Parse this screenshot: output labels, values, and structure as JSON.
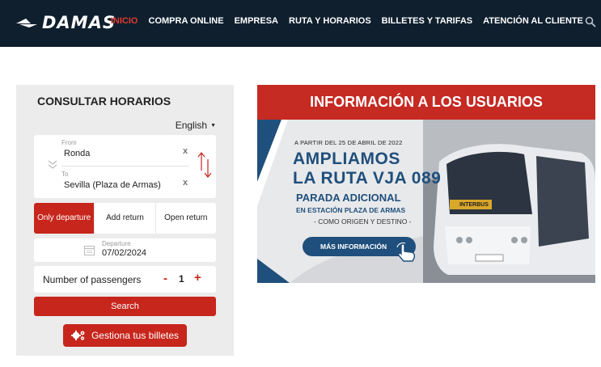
{
  "header": {
    "logo_text": "DAMAS",
    "nav": [
      "INICIO",
      "COMPRA ONLINE",
      "EMPRESA",
      "RUTA Y HORARIOS",
      "BILLETES Y TARIFAS",
      "ATENCIÓN AL CLIENTE"
    ],
    "active_nav": "INICIO",
    "icons": [
      "bus-logo-icon",
      "search-icon"
    ]
  },
  "panel": {
    "title": "CONSULTAR HORARIOS",
    "language": "English",
    "from_label": "From",
    "from_value": "Ronda",
    "to_label": "To",
    "to_value": "Sevilla (Plaza de Armas)",
    "clear_symbol": "x",
    "trip_tabs": [
      "Only departure",
      "Add return",
      "Open return"
    ],
    "date_label": "Departure",
    "date_value": "07/02/2024",
    "passengers_label": "Number of passengers",
    "passengers_minus": "-",
    "passengers_count": "1",
    "passengers_plus": "+",
    "search_label": "Search",
    "manage_label": "Gestiona tus billetes"
  },
  "banner": {
    "title": "INFORMACIÓN A LOS USUARIOS",
    "date_line": "A PARTIR DEL 25 DE ABRIL DE 2022",
    "headline1": "AMPLIAMOS",
    "headline2": "LA RUTA VJA 089",
    "sub1": "PARADA ADICIONAL",
    "sub2": "EN ESTACIÓN PLAZA DE ARMAS",
    "sub3": "- COMO ORIGEN Y DESTINO -",
    "button": "MÁS INFORMACIÓN",
    "bus_sign": "INTERBUS",
    "colors": {
      "red": "#c52a23",
      "blue": "#1f4f7c"
    }
  },
  "colors": {
    "header_bg": "#0f1f2e",
    "accent": "#c7261c",
    "active_nav": "#e03a2f"
  }
}
